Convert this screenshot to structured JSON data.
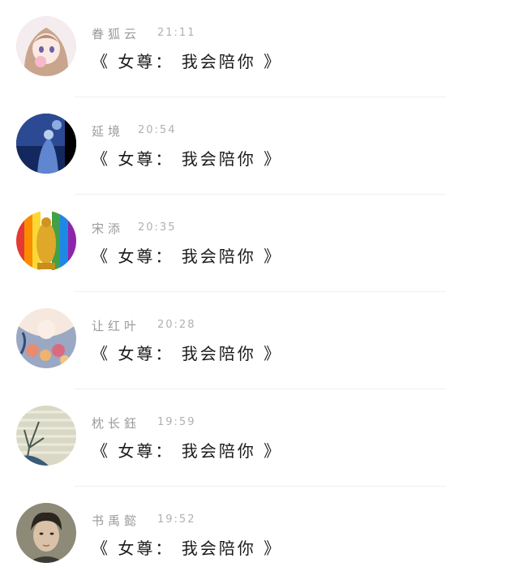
{
  "messages": [
    {
      "name": "眷狐云",
      "time": "21:11",
      "text": "《 女尊： 我会陪你 》",
      "avatar_icon": "anime-girl-avatar"
    },
    {
      "name": "延境",
      "time": "20:54",
      "text": "《 女尊： 我会陪你 》",
      "avatar_icon": "night-blue-avatar"
    },
    {
      "name": "宋添",
      "time": "20:35",
      "text": "《 女尊： 我会陪你 》",
      "avatar_icon": "golden-buddha-avatar"
    },
    {
      "name": "让红叶",
      "time": "20:28",
      "text": "《 女尊： 我会陪你 》",
      "avatar_icon": "floral-girl-avatar"
    },
    {
      "name": "枕长鈺",
      "time": "19:59",
      "text": "《 女尊： 我会陪你 》",
      "avatar_icon": "branch-blinds-avatar"
    },
    {
      "name": "书禹懿",
      "time": "19:52",
      "text": "《 女尊： 我会陪你 》",
      "avatar_icon": "boy-portrait-avatar"
    }
  ]
}
